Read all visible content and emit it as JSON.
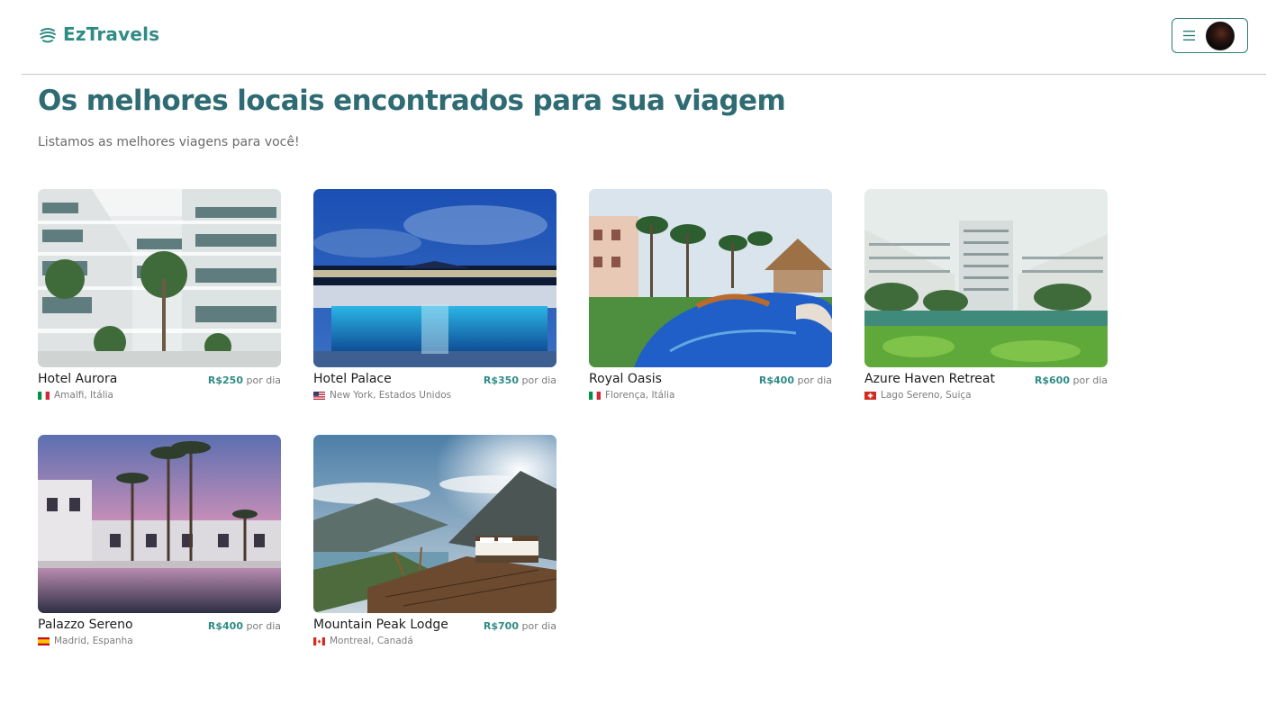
{
  "app": {
    "brand": "EzTravels",
    "accent_color": "#2f8c85",
    "title_color": "#2e6b72"
  },
  "header": {
    "logo_icon": "dish-stack-icon",
    "menu_icon": "hamburger-icon",
    "avatar": "user-avatar"
  },
  "main": {
    "title": "Os melhores locais encontrados para sua viagem",
    "subtitle": "Listamos as melhores viagens para você!"
  },
  "price_suffix": "por dia",
  "hotels": [
    {
      "name": "Hotel Aurora",
      "price": "R$250",
      "location": "Amalfi, Itália",
      "flag": "italy-flag"
    },
    {
      "name": "Hotel Palace",
      "price": "R$350",
      "location": "New York, Estados Unidos",
      "flag": "usa-flag"
    },
    {
      "name": "Royal Oasis",
      "price": "R$400",
      "location": "Florença, Itália",
      "flag": "italy-flag"
    },
    {
      "name": "Azure Haven Retreat",
      "price": "R$600",
      "location": "Lago Sereno, Suiça",
      "flag": "switzerland-flag"
    },
    {
      "name": "Palazzo Sereno",
      "price": "R$400",
      "location": "Madrid, Espanha",
      "flag": "spain-flag"
    },
    {
      "name": "Mountain Peak Lodge",
      "price": "R$700",
      "location": "Montreal, Canadá",
      "flag": "canada-flag"
    }
  ]
}
